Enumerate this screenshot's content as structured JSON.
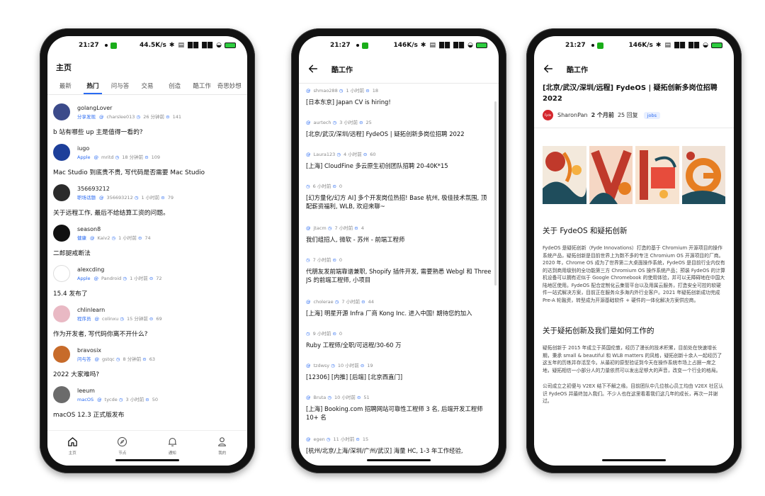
{
  "status_bars": [
    {
      "time": "21:27",
      "net": "44.5K/s",
      "glyphs": "✱ ▤ ▇▇ ▇▇ ◒"
    },
    {
      "time": "21:27",
      "net": "146K/s",
      "glyphs": "✱ ▤ ▇▇ ▇▇ ◒"
    },
    {
      "time": "21:27",
      "net": "146K/s",
      "glyphs": "✱ ▤ ▇▇ ▇▇ ◒"
    }
  ],
  "home": {
    "title": "主页",
    "tabs": [
      "最新",
      "热门",
      "问与答",
      "交易",
      "创造",
      "酷工作",
      "奇思妙想"
    ],
    "active_tab": "热门",
    "topics": [
      {
        "user": "golangLover",
        "node": "分享发现",
        "author": "charslee013",
        "time": "26 分钟前",
        "replies": "141",
        "title": "b 站有哪些 up 主是值得一看的?",
        "avatar_color": "#3b4a8a"
      },
      {
        "user": "iugo",
        "node": "Apple",
        "author": "mritd",
        "time": "18 分钟前",
        "replies": "109",
        "title": "Mac Studio 到底贵不贵, 写代码是否需要 Mac Studio",
        "avatar_color": "#1d3f9a"
      },
      {
        "user": "356693212",
        "node": "职场话题",
        "author": "356693212",
        "time": "1 小时前",
        "replies": "79",
        "title": "关于远程工作, 最后不给结算工资的问题。",
        "avatar_color": "#2b2b2b"
      },
      {
        "user": "season8",
        "node": "健康",
        "author": "Kaiv2",
        "time": "1 小时前",
        "replies": "74",
        "title": "二郎腿戒断法",
        "avatar_color": "#111111"
      },
      {
        "user": "alexcding",
        "node": "Apple",
        "author": "Pandroid",
        "time": "1 小时前",
        "replies": "72",
        "title": "15.4 发布了",
        "avatar_color": "#ffffff"
      },
      {
        "user": "chlinlearn",
        "node": "程序员",
        "author": "colinxu",
        "time": "15 分钟前",
        "replies": "69",
        "title": "作为开发者, 写代码你离不开什么?",
        "avatar_color": "#e9b9c4"
      },
      {
        "user": "bravosix",
        "node": "问与答",
        "author": "gstqc",
        "time": "8 分钟前",
        "replies": "63",
        "title": "2022 大家难吗?",
        "avatar_color": "#c76b2a"
      },
      {
        "user": "leeum",
        "node": "macOS",
        "author": "tycde",
        "time": "3 小时前",
        "replies": "50",
        "title": "macOS 12.3 正式版发布",
        "avatar_color": "#6b6b6b"
      }
    ],
    "nav": [
      "主页",
      "节点",
      "通知",
      "我的"
    ]
  },
  "jobs": {
    "title": "酷工作",
    "items": [
      {
        "author": "shmao288",
        "time": "1 小时前",
        "replies": "18",
        "title": "[日本东京] Japan CV is hiring!",
        "lines": 1
      },
      {
        "author": "aurtech",
        "time": "3 小时前",
        "replies": "25",
        "title": "[北京/武汉/深圳/远程] FydeOS | 疑拓创新多岗位招聘 2022",
        "lines": 1
      },
      {
        "author": "Laura123",
        "time": "4 小时前",
        "replies": "60",
        "title": "[上海] CloudFine 多云原生初创团队招聘 20-40K*15",
        "lines": 1
      },
      {
        "author": "",
        "time": "6 小时前",
        "replies": "0",
        "title": "[幻方量化/幻方 AI] 多个开发岗位热招! Base 杭州, 极佳技术氛围, 顶配薪资福利, WLB, 欢迎来聊~",
        "lines": 2
      },
      {
        "author": "jtacm",
        "time": "7 小时前",
        "replies": "4",
        "title": "我们组招人, 微软 - 苏州 - 前端工程师",
        "lines": 1
      },
      {
        "author": "",
        "time": "7 小时前",
        "replies": "0",
        "title": "代朋友发前端靠谱兼职, Shopify 插件开发, 需要熟悉 Webgl 和 Three JS 的前端工程师, 小项目",
        "lines": 2
      },
      {
        "author": "cholerae",
        "time": "7 小时前",
        "replies": "44",
        "title": "[上海] 明星开源 Infra 厂商 Kong Inc. 进入中国! 期待您的加入",
        "lines": 1
      },
      {
        "author": "",
        "time": "9 小时前",
        "replies": "0",
        "title": "Ruby 工程师/全职/可远程/30-60 万",
        "lines": 1
      },
      {
        "author": "tzdwsy",
        "time": "10 小时前",
        "replies": "19",
        "title": "[12306] [内推] [后端] [北京西直门]",
        "lines": 1
      },
      {
        "author": "Bruta",
        "time": "10 小时前",
        "replies": "51",
        "title": "[上海] Booking.com 招聘网站可靠性工程师 3 名, 后端开发工程师 10+ 名",
        "lines": 2
      },
      {
        "author": "egen",
        "time": "11 小时前",
        "replies": "15",
        "title": "[杭州/北京/上海/深圳/广州/武汉] 海量 HC, 1-3 年工作经验,",
        "lines": 1
      }
    ]
  },
  "detail": {
    "title": "酷工作",
    "post_title": "[北京/武汉/深圳/远程] FydeOS | 疑拓创新多岗位招聘 2022",
    "avatar_label": "Fyde",
    "author": "SharonPan",
    "ago": "2 个月前",
    "replies": "25 回复",
    "tag": "jobs",
    "h1": "关于 FydeOS 和疑拓创新",
    "p1": "FydeOS 是疑拓创新（Fyde Innovations）打造的基于 Chromium 开源项目的操作系统产品，疑拓创新是目前世界上为数不多的专注 Chromium OS 开源项目的厂商。2020 年，Chrome OS 成为了世界第二大桌面操作系统，FydeOS 是目前行业内仅有的达到商用级别的全功能第三方 Chromium OS 操作系统产品；预装 FydeOS 的计算机设备可以拥有近似于 Google Chromebook 的使用体验，并可以无障碍地在中国大陆地区使用。FydeOS 配合定制化云集管平台以及用属云服务，打造安全可控的软硬件一站式解决方案，目前正在服务众多海内外行业客户。2021 年疑拓创新成功完成 Pre-A 轮融资，转型成为开源基础软件 + 硬件的一体化解决方案供应商。",
    "h2": "关于疑拓创新及我们是如何工作的",
    "p2": "疑拓创新于 2015 年成立于英国伦敦，经历了漫长的技术积累，目前处在快速增长期，秉承 small & beautiful 和 WLB matters 的风格，疑拓创新十余人一起经历了这五年的历练并存活至今。从最初的原型验证到今天在操作系统市场上占据一席之地，疑拓相信一小部分人的力量依然可以发出足够大的声音，改变一个行业的格局。",
    "p3": "公司成立之初便与 V2EX 结下不解之缘。目前团队中几位核心员工均由 V2EX 社区认识 FydeOS 并最终加入我们。不少人也在这里看着我们这几年的成长，再次一并谢过。"
  },
  "colors": {
    "accent": "#2a6bf2",
    "frame": "#121212",
    "tag_bg": "#e8efff",
    "fyde_red": "#d4272d"
  }
}
